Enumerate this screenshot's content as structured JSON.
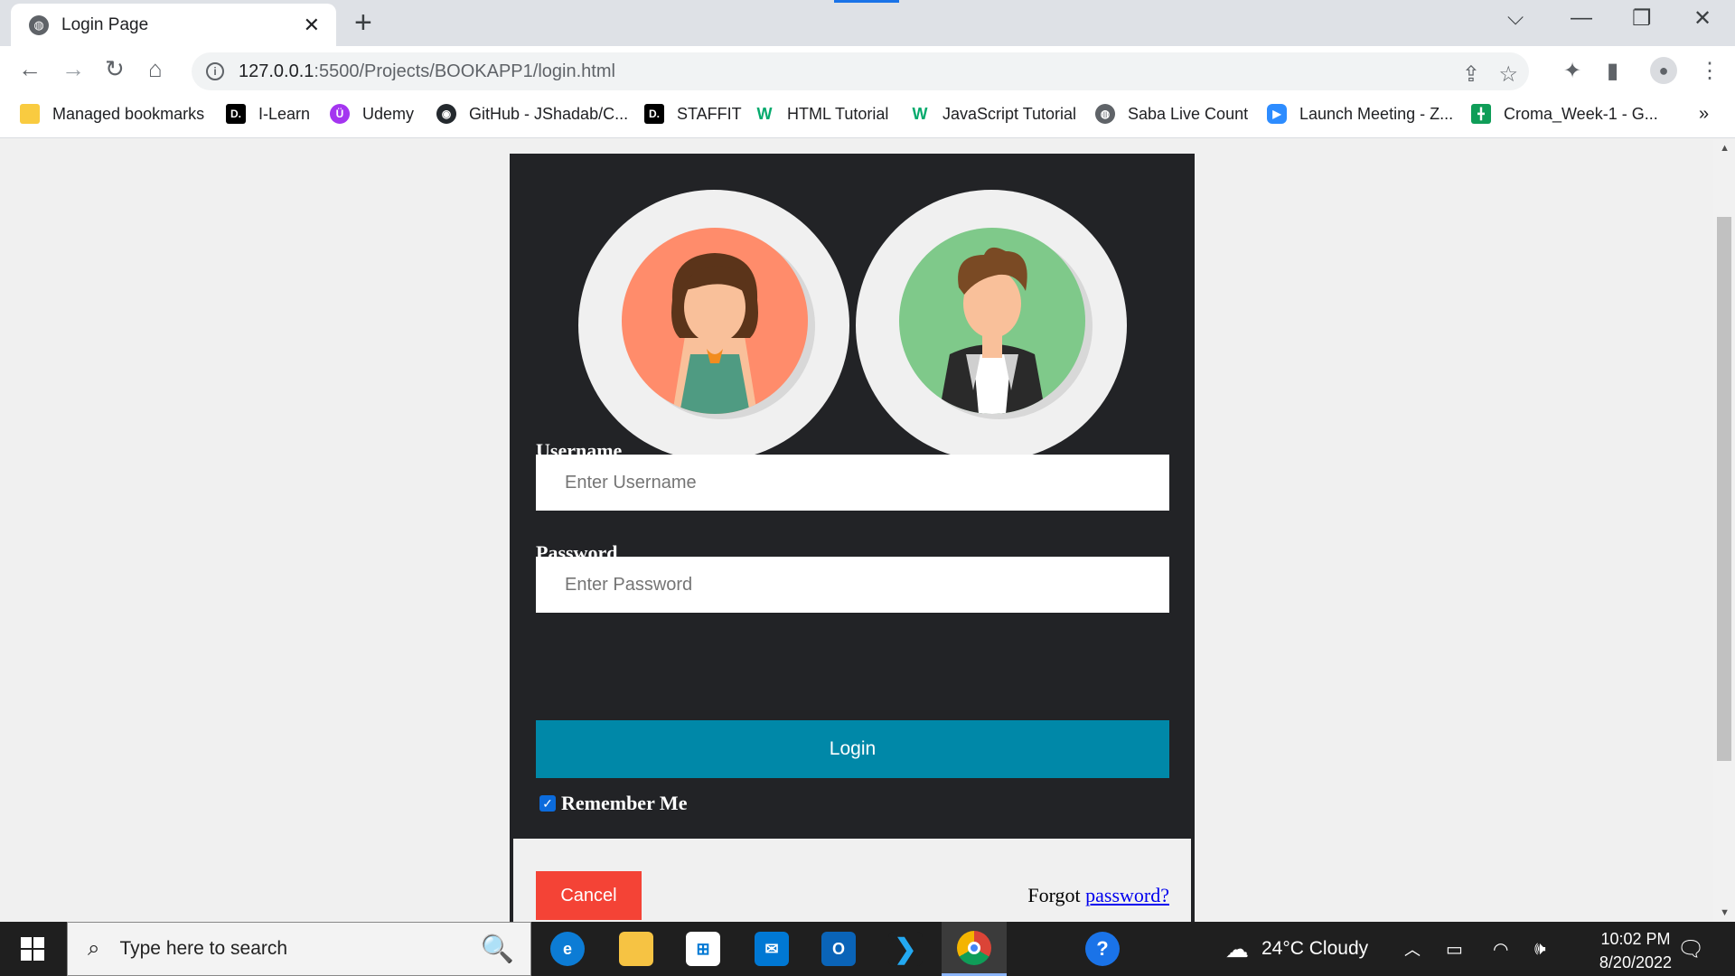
{
  "browser": {
    "tab_title": "Login Page",
    "url_host": "127.0.0.1",
    "url_path": ":5500/Projects/BOOKAPP1/login.html",
    "bookmarks": [
      {
        "label": "Managed bookmarks",
        "icon": "folder-icon",
        "color": "#f9cb40"
      },
      {
        "label": "I-Learn",
        "icon": "d-logo-icon",
        "color": "#000000"
      },
      {
        "label": "Udemy",
        "icon": "udemy-icon",
        "color": "#a435f0"
      },
      {
        "label": "GitHub - JShadab/C...",
        "icon": "github-icon",
        "color": "#24292e"
      },
      {
        "label": "STAFFIT",
        "icon": "d-logo-icon",
        "color": "#000000"
      },
      {
        "label": "HTML Tutorial",
        "icon": "w3schools-icon",
        "color": "#04aa6d"
      },
      {
        "label": "JavaScript Tutorial",
        "icon": "w3schools-icon",
        "color": "#04aa6d"
      },
      {
        "label": "Saba Live Count",
        "icon": "globe-icon",
        "color": "#5f6368"
      },
      {
        "label": "Launch Meeting - Z...",
        "icon": "zoom-icon",
        "color": "#2d8cff"
      },
      {
        "label": "Croma_Week-1 - G...",
        "icon": "sheets-icon",
        "color": "#0f9d58"
      }
    ],
    "more_bookmarks": "»"
  },
  "login": {
    "username_label": "Username",
    "username_placeholder": "Enter Username",
    "password_label": "Password",
    "password_placeholder": "Enter Password",
    "login_button": "Login",
    "remember_label": "Remember Me",
    "remember_checked": true,
    "cancel_button": "Cancel",
    "forgot_text": "Forgot",
    "forgot_link": "password?"
  },
  "colors": {
    "card_bg": "#222326",
    "login_btn": "#0088a8",
    "cancel_btn": "#f44336",
    "avatar_female_bg": "#ff8c6b",
    "avatar_male_bg": "#7fc98a"
  },
  "taskbar": {
    "search_placeholder": "Type here to search",
    "weather": "24°C  Cloudy",
    "time": "10:02 PM",
    "date": "8/20/2022"
  }
}
